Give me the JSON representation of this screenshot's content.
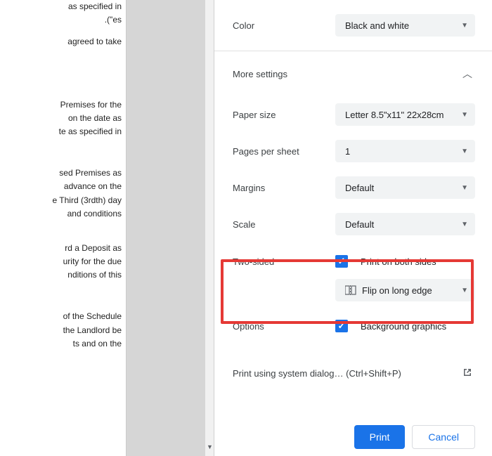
{
  "doc": {
    "frag1": [
      "as specified in",
      "es\")."
    ],
    "frag2": [
      "agreed to take"
    ],
    "frag3": [
      "Premises for the",
      "on the date as",
      "te as specified in"
    ],
    "frag4": [
      "sed Premises as",
      "advance on the",
      "e Third (3rdth) day",
      "and conditions"
    ],
    "frag5": [
      "rd a Deposit as",
      "urity for the due",
      "nditions of this"
    ],
    "frag6": [
      "of the Schedule",
      "the Landlord be",
      "ts and on the"
    ]
  },
  "settings": {
    "color": {
      "label": "Color",
      "value": "Black and white"
    },
    "more_label": "More settings",
    "paper": {
      "label": "Paper size",
      "value": "Letter 8.5\"x11\" 22x28cm"
    },
    "pages_per_sheet": {
      "label": "Pages per sheet",
      "value": "1"
    },
    "margins": {
      "label": "Margins",
      "value": "Default"
    },
    "scale": {
      "label": "Scale",
      "value": "Default"
    },
    "two_sided": {
      "label": "Two-sided",
      "check_label": "Print on both sides",
      "flip_value": "Flip on long edge"
    },
    "options": {
      "label": "Options",
      "check_label": "Background graphics"
    },
    "system_dialog": {
      "text": "Print using system dialog…",
      "shortcut": "(Ctrl+Shift+P)"
    }
  },
  "buttons": {
    "print": "Print",
    "cancel": "Cancel"
  }
}
